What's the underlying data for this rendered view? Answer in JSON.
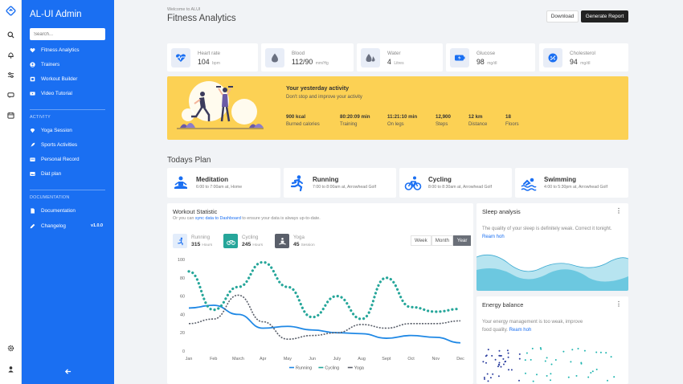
{
  "app": {
    "title": "AL-UI Admin",
    "version": "v1.0.0"
  },
  "search": {
    "placeholder": "Search..."
  },
  "sidebar": {
    "items": [
      {
        "label": "Fitness Analytics"
      },
      {
        "label": "Trainers"
      },
      {
        "label": "Workout Builder"
      },
      {
        "label": "Video Tutorial"
      }
    ],
    "activity_heading": "ACTIVITY",
    "activity_items": [
      {
        "label": "Yoga Session"
      },
      {
        "label": "Sports Activities"
      },
      {
        "label": "Personal Record"
      },
      {
        "label": "Diat plan"
      }
    ],
    "docs_heading": "DOCUMENTATION",
    "docs_items": [
      {
        "label": "Documentation"
      },
      {
        "label": "Changelog"
      }
    ]
  },
  "header": {
    "welcome": "Welcome to ALUI",
    "title": "Fitness Analytics",
    "download_label": "Download",
    "report_label": "Generate Report"
  },
  "stats": [
    {
      "label": "Heart rate",
      "value": "104",
      "unit": "bpm",
      "icon": "heart-rate-icon"
    },
    {
      "label": "Blood",
      "value": "112/90",
      "unit": "mm/Hg",
      "icon": "blood-drop-icon"
    },
    {
      "label": "Water",
      "value": "4",
      "unit": "Litres",
      "icon": "water-icon"
    },
    {
      "label": "Glucose",
      "value": "98",
      "unit": "mg/dl",
      "icon": "battery-icon"
    },
    {
      "label": "Cholesterol",
      "value": "94",
      "unit": "mg/dl",
      "icon": "cholesterol-icon"
    }
  ],
  "activity": {
    "title": "Your yesterday activity",
    "subtitle": "Don't stop and improve your activity",
    "metrics": [
      {
        "value": "900 kcal",
        "label": "Burned calories"
      },
      {
        "value": "80:20:09 min",
        "label": "Training"
      },
      {
        "value": "11:21:10 min",
        "label": "On legs"
      },
      {
        "value": "12,900",
        "label": "Steps"
      },
      {
        "value": "12 km",
        "label": "Distance"
      },
      {
        "value": "18",
        "label": "Floors"
      }
    ]
  },
  "plan": {
    "title": "Todays Plan",
    "items": [
      {
        "name": "Meditation",
        "time": "6:00 to 7:00am at, Home"
      },
      {
        "name": "Running",
        "time": "7:00 to 8:00am at, Arrowhead Golf"
      },
      {
        "name": "Cycling",
        "time": "8:00 to 8:30am at, Arrowhead Golf"
      },
      {
        "name": "Swimming",
        "time": "4:00 to 5:30pm at, Arrowhead Golf"
      }
    ]
  },
  "workout": {
    "title": "Workout Statistic",
    "sub_prefix": "Or you can ",
    "sub_link": "sync data to Dashboard",
    "sub_suffix": " to ensure your data is always up-to-date.",
    "legend": [
      {
        "name": "Running",
        "value": "315",
        "unit": "Hours"
      },
      {
        "name": "Cycling",
        "value": "245",
        "unit": "Hours"
      },
      {
        "name": "Yoga",
        "value": "45",
        "unit": "Session"
      }
    ],
    "tabs": [
      "Week",
      "Month",
      "Year"
    ],
    "active_tab": "Year"
  },
  "chart_data": {
    "type": "line",
    "categories": [
      "Jan",
      "Feb",
      "March",
      "Apr",
      "May",
      "Jun",
      "July",
      "Aug",
      "Sept",
      "Oct",
      "Nov",
      "Dec"
    ],
    "ylim": [
      0,
      100
    ],
    "yticks": [
      0,
      20,
      40,
      60,
      80,
      100
    ],
    "legend_position": "bottom",
    "series": [
      {
        "name": "Running",
        "color": "#1f88e5",
        "style": "solid",
        "values": [
          47,
          50,
          40,
          25,
          27,
          23,
          20,
          19,
          14,
          17,
          15,
          9
        ]
      },
      {
        "name": "Cycling",
        "color": "#26a69a",
        "style": "dotted",
        "values": [
          87,
          45,
          70,
          97,
          70,
          37,
          60,
          35,
          80,
          48,
          43,
          46
        ]
      },
      {
        "name": "Yoga",
        "color": "#5a5f6a",
        "style": "dashed",
        "values": [
          30,
          35,
          61,
          32,
          13,
          17,
          20,
          29,
          25,
          30,
          30,
          33
        ]
      }
    ]
  },
  "sleep": {
    "title": "Sleep analysis",
    "text": "The quality of your sleep is definitely weak. Correct it tonight.",
    "link": "Ream hoh"
  },
  "energy": {
    "title": "Energy balance",
    "text": "Your energy management is too weak, improve food quality.",
    "link": "Ream hoh"
  }
}
